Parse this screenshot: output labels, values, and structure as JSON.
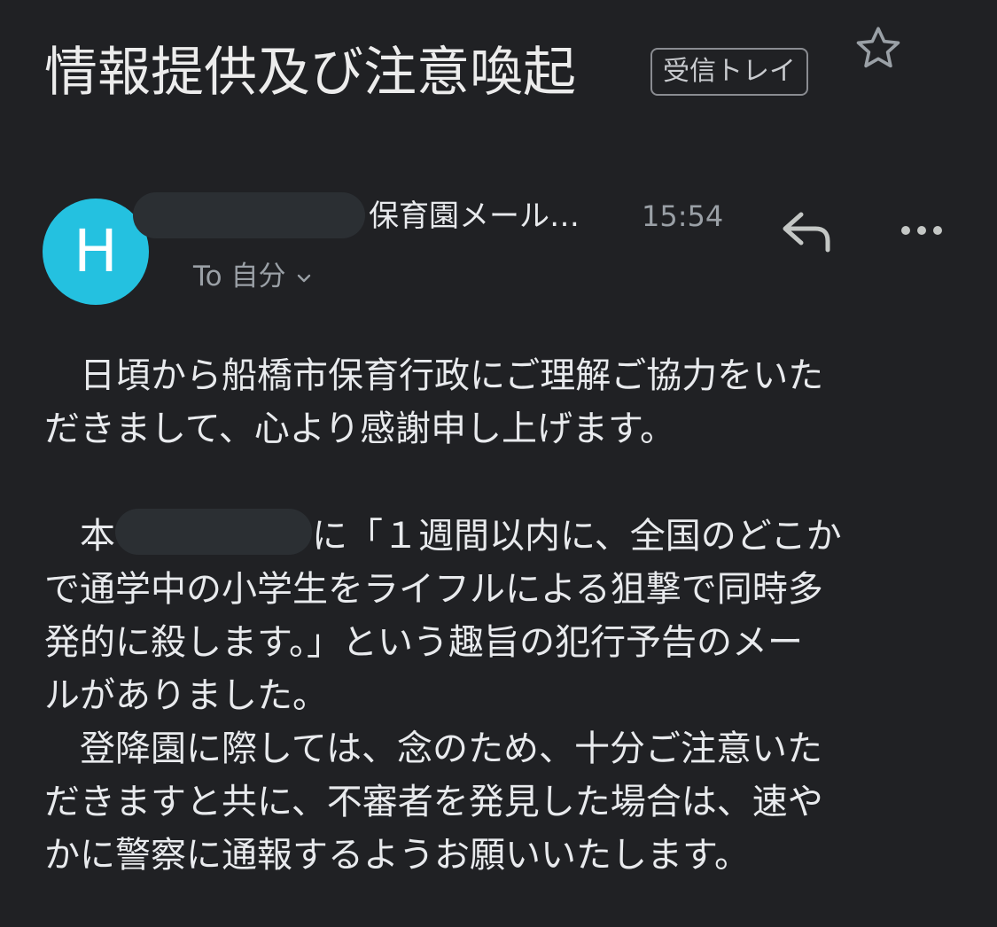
{
  "email": {
    "subject": "情報提供及び注意喚起",
    "label": "受信トレイ",
    "sender_suffix": "保育園メール…",
    "avatar_letter": "H",
    "time": "15:54",
    "recipient": "To 自分"
  },
  "icons": {
    "star": "star-outline-icon",
    "reply": "reply-icon",
    "more": "more-horizontal-icon",
    "expand": "chevron-down-icon"
  },
  "colors": {
    "background": "#202124",
    "avatar": "#24c1e0",
    "text_primary": "#e8eaed",
    "text_secondary": "#9aa0a6"
  },
  "body": {
    "p1_line1": "　日頃から船橋市保育行政にご理解ご協力をいた",
    "p1_line2": "だきまして、心より感謝申し上げます。",
    "p2_line1_a": "　本",
    "p2_line1_b": "に「１週間以内に、全国のどこか",
    "p2_line2": "で通学中の小学生をライフルによる狙撃で同時多",
    "p2_line3": "発的に殺します。」という趣旨の犯行予告のメー",
    "p2_line4": "ルがありました。",
    "p3_line1": "　登降園に際しては、念のため、十分ご注意いた",
    "p3_line2": "だきますと共に、不審者を発見した場合は、速や",
    "p3_line3": "かに警察に通報するようお願いいたします。"
  }
}
